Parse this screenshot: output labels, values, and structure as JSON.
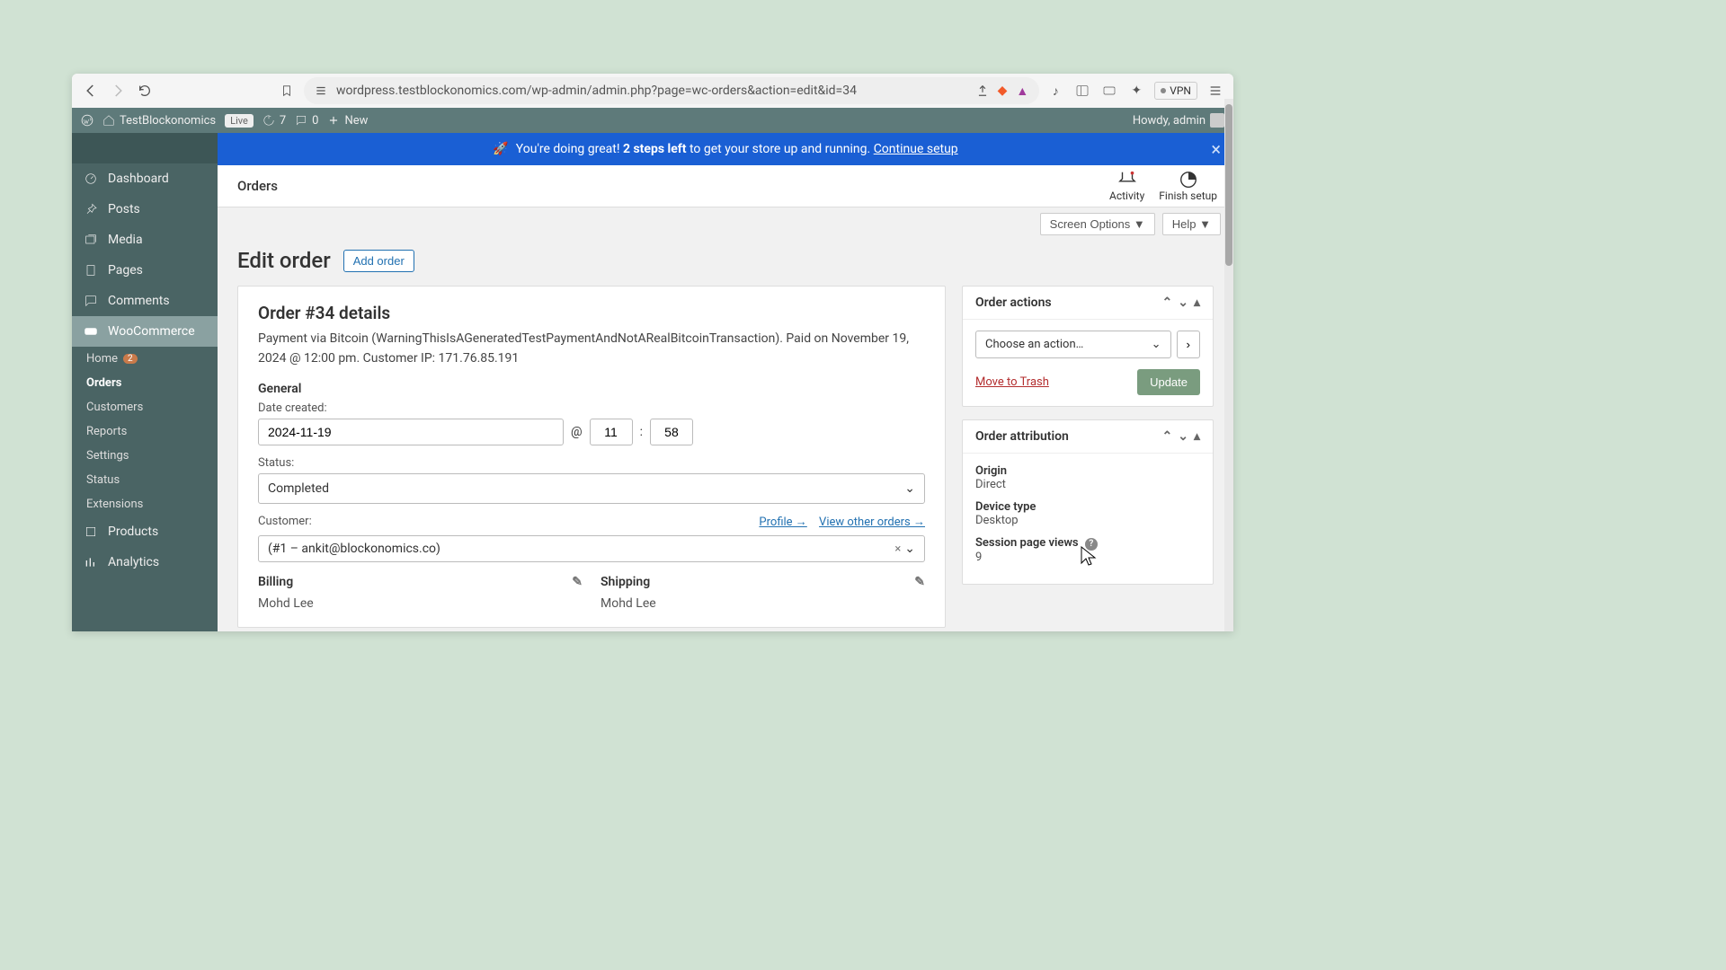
{
  "browser": {
    "url": "wordpress.testblockonomics.com/wp-admin/admin.php?page=wc-orders&action=edit&id=34",
    "vpn": "VPN"
  },
  "wpbar": {
    "site": "TestBlockonomics",
    "live": "Live",
    "updates": "7",
    "comments": "0",
    "new": "New",
    "howdy": "Howdy, admin"
  },
  "sidebar": {
    "items": [
      "Dashboard",
      "Posts",
      "Media",
      "Pages",
      "Comments",
      "WooCommerce",
      "Products",
      "Analytics"
    ],
    "home": "Home",
    "home_badge": "2",
    "sub": [
      "Orders",
      "Customers",
      "Reports",
      "Settings",
      "Status",
      "Extensions"
    ]
  },
  "banner": {
    "text_prefix": "You're doing great! ",
    "text_bold": "2 steps left",
    "text_suffix": " to get your store up and running. ",
    "link": "Continue setup"
  },
  "topbar": {
    "crumb": "Orders",
    "activity": "Activity",
    "finish": "Finish setup"
  },
  "options": {
    "screen": "Screen Options",
    "help": "Help"
  },
  "page": {
    "title": "Edit order",
    "add": "Add order"
  },
  "order": {
    "details_title": "Order #34 details",
    "summary": "Payment via Bitcoin (WarningThisIsAGeneratedTestPaymentAndNotARealBitcoinTransaction). Paid on November 19, 2024 @ 12:00 pm. Customer IP: 171.76.85.191",
    "general_label": "General",
    "date_label": "Date created:",
    "date_value": "2024-11-19",
    "at": "@",
    "hour": "11",
    "colon": ":",
    "minute": "58",
    "status_label": "Status:",
    "status_value": "Completed",
    "customer_label": "Customer:",
    "profile_link": "Profile →",
    "other_orders_link": "View other orders →",
    "customer_value": "(#1 – ankit@blockonomics.co)",
    "billing_label": "Billing",
    "shipping_label": "Shipping",
    "billing_name": "Mohd Lee",
    "shipping_name": "Mohd Lee"
  },
  "actions": {
    "title": "Order actions",
    "select": "Choose an action…",
    "trash": "Move to Trash",
    "update": "Update"
  },
  "attribution": {
    "title": "Order attribution",
    "origin_label": "Origin",
    "origin_value": "Direct",
    "device_label": "Device type",
    "device_value": "Desktop",
    "views_label": "Session page views",
    "views_value": "9"
  }
}
